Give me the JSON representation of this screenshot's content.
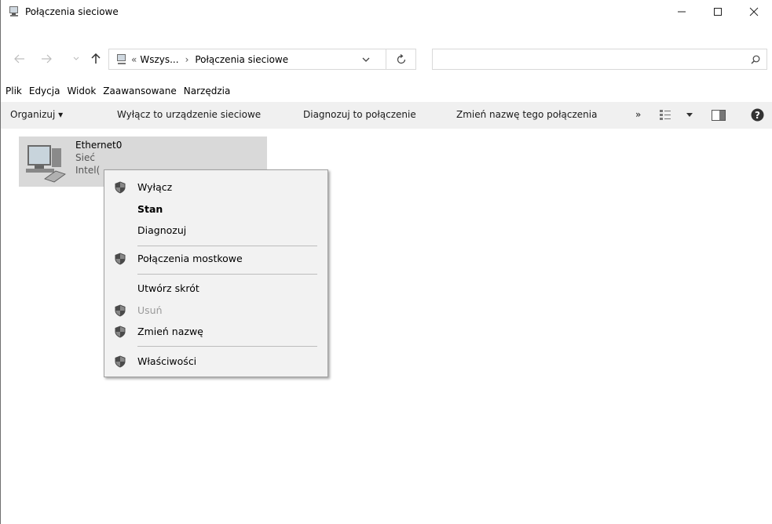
{
  "window": {
    "title": "Połączenia sieciowe"
  },
  "address": {
    "chevrons": "«",
    "crumb1": "Wszys...",
    "separator": "›",
    "crumb2": "Połączenia sieciowe",
    "search_placeholder": ""
  },
  "menu": [
    "Plik",
    "Edycja",
    "Widok",
    "Zaawansowane",
    "Narzędzia"
  ],
  "commands": {
    "organize": "Organizuj ▾",
    "disable": "Wyłącz to urządzenie sieciowe",
    "diagnose": "Diagnozuj to połączenie",
    "rename": "Zmień nazwę tego połączenia",
    "more": "»"
  },
  "connection": {
    "name": "Ethernet0",
    "network": "Sieć",
    "adapter": "Intel("
  },
  "context_menu": {
    "items": [
      {
        "label": "Wyłącz",
        "shield": true
      },
      {
        "label": "Stan",
        "bold": true
      },
      {
        "label": "Diagnozuj"
      },
      {
        "label": "Połączenia mostkowe",
        "shield": true
      },
      {
        "label": "Utwórz skrót"
      },
      {
        "label": "Usuń",
        "shield": true,
        "disabled": true
      },
      {
        "label": "Zmień nazwę",
        "shield": true
      },
      {
        "label": "Właściwości",
        "shield": true
      }
    ]
  },
  "icons": [
    "network-connections-icon",
    "minimize-icon",
    "maximize-icon",
    "close-icon",
    "back-arrow-icon",
    "forward-arrow-icon",
    "recent-dropdown-icon",
    "up-arrow-icon",
    "refresh-icon",
    "search-icon",
    "view-options-icon",
    "preview-pane-icon",
    "help-icon",
    "uac-shield-icon"
  ]
}
